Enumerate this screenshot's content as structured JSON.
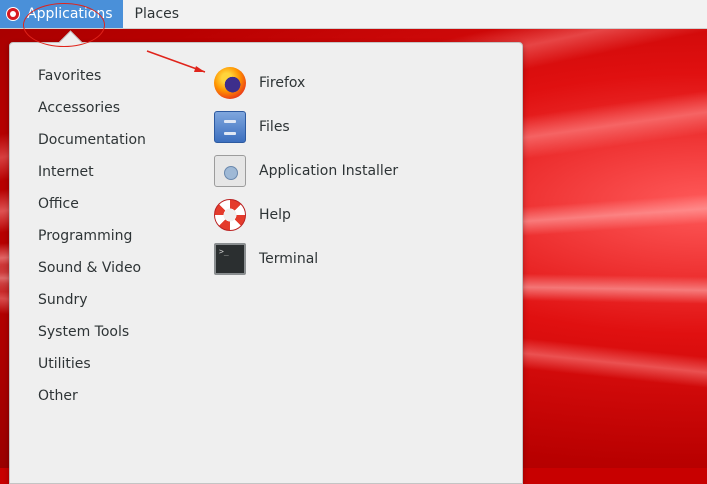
{
  "topbar": {
    "applications_label": "Applications",
    "places_label": "Places"
  },
  "categories": [
    "Favorites",
    "Accessories",
    "Documentation",
    "Internet",
    "Office",
    "Programming",
    "Sound & Video",
    "Sundry",
    "System Tools",
    "Utilities",
    "Other"
  ],
  "apps": [
    {
      "label": "Firefox",
      "icon": "firefox-icon"
    },
    {
      "label": "Files",
      "icon": "files-icon"
    },
    {
      "label": "Application Installer",
      "icon": "application-installer-icon"
    },
    {
      "label": "Help",
      "icon": "help-icon"
    },
    {
      "label": "Terminal",
      "icon": "terminal-icon"
    }
  ],
  "colors": {
    "active_menu": "#4a90d9",
    "annotation": "#e0241b",
    "desktop": "#c80000"
  }
}
